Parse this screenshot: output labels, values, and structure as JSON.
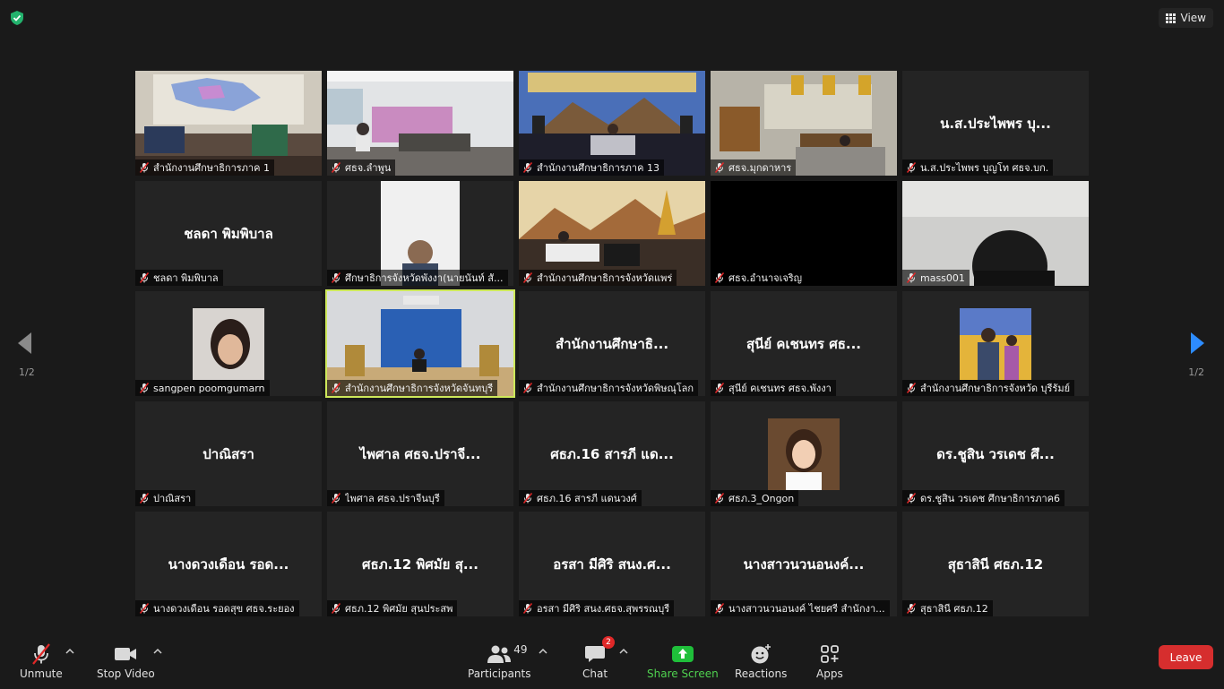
{
  "top_bar": {
    "view_label": "View"
  },
  "tiles": [
    {
      "big": "",
      "label": "สำนักงานศึกษาธิการภาค 1",
      "video": "office-map"
    },
    {
      "big": "",
      "label": "ศธจ.ลำพูน",
      "video": "meeting-room"
    },
    {
      "big": "",
      "label": "สำนักงานศึกษาธิการภาค 13",
      "video": "stage-banner"
    },
    {
      "big": "",
      "label": "ศธจ.มุกดาหาร",
      "video": "office-desk"
    },
    {
      "big": "น.ส.ประไพพร บุ...",
      "label": "น.ส.ประไพพร บุญโท ศธจ.บก.",
      "video": ""
    },
    {
      "big": "ชลดา พิมพิบาล",
      "label": "ชลดา พิมพิบาล",
      "video": ""
    },
    {
      "big": "",
      "label": "ศึกษาธิการจังหวัดพังงา(นายนันท์ สั...",
      "video": "portrait-man"
    },
    {
      "big": "",
      "label": "สำนักงานศึกษาธิการจังหวัดแพร่",
      "video": "stage-mural"
    },
    {
      "big": "",
      "label": "ศธจ.อำนาจเจริญ",
      "video": "black"
    },
    {
      "big": "",
      "label": "mass001",
      "video": "closeup"
    },
    {
      "big": "",
      "label": "sangpen poomgumarn",
      "video": "avatar-woman"
    },
    {
      "big": "",
      "label": "สำนักงานศึกษาธิการจังหวัดจันทบุรี",
      "video": "blue-room"
    },
    {
      "big": "สำนักงานศึกษาธิ...",
      "label": "สำนักงานศึกษาธิการจังหวัดพิษณุโลก",
      "video": ""
    },
    {
      "big": "สุนีย์  คเชนทร ศธ...",
      "label": "สุนีย์  คเชนทร ศธจ.พังงา",
      "video": ""
    },
    {
      "big": "",
      "label": "สำนักงานศึกษาธิการจังหวัด บุรีรัมย์",
      "video": "avatar-event"
    },
    {
      "big": "ปาณิสรา",
      "label": "ปาณิสรา",
      "video": ""
    },
    {
      "big": "ไพศาล ศธจ.ปราจี...",
      "label": "ไพศาล ศธจ.ปราจีนบุรี",
      "video": ""
    },
    {
      "big": "ศธภ.16 สารภี แด...",
      "label": "ศธภ.16 สารภี แดนวงศ์",
      "video": ""
    },
    {
      "big": "",
      "label": "ศธภ.3_Ongon",
      "video": "avatar-woman2"
    },
    {
      "big": "ดร.ชูสิน วรเดช ศึ...",
      "label": "ดร.ชูสิน วรเดช ศึกษาธิการภาค6",
      "video": ""
    },
    {
      "big": "นางดวงเดือน รอด...",
      "label": "นางดวงเดือน รอดสุข  ศธจ.ระยอง",
      "video": ""
    },
    {
      "big": "ศธภ.12 พิศมัย สุ...",
      "label": "ศธภ.12 พิศมัย สุนประสพ",
      "video": ""
    },
    {
      "big": "อรสา มีศิริ สนง.ศ...",
      "label": "อรสา มีศิริ สนง.ศธจ.สุพรรณบุรี",
      "video": ""
    },
    {
      "big": "นางสาวนวนอนงค์...",
      "label": "นางสาวนวนอนงค์  ไชยศรี สำนักงา...",
      "video": ""
    },
    {
      "big": "สุธาสินี ศธภ.12",
      "label": "สุธาสินี ศธภ.12",
      "video": ""
    }
  ],
  "active_tile_index": 11,
  "pager": {
    "left_indicator": "1/2",
    "right_indicator": "1/2"
  },
  "toolbar": {
    "unmute_label": "Unmute",
    "stop_video_label": "Stop Video",
    "participants_label": "Participants",
    "participants_count": "49",
    "chat_label": "Chat",
    "chat_badge": "2",
    "share_label": "Share Screen",
    "reactions_label": "Reactions",
    "apps_label": "Apps",
    "leave_label": "Leave"
  },
  "colors": {
    "background": "#1a1a1a",
    "tile": "#242424",
    "active_border": "#cde85a",
    "share_green": "#4fd14f",
    "leave_red": "#d62e2e",
    "nav_blue": "#2d8cff"
  },
  "icons": [
    "shield-icon",
    "grid-icon",
    "mic-muted-icon",
    "camera-icon",
    "participants-icon",
    "chat-icon",
    "share-icon",
    "reactions-icon",
    "apps-icon",
    "chevron-left-icon",
    "chevron-right-icon",
    "caret-up-icon"
  ]
}
